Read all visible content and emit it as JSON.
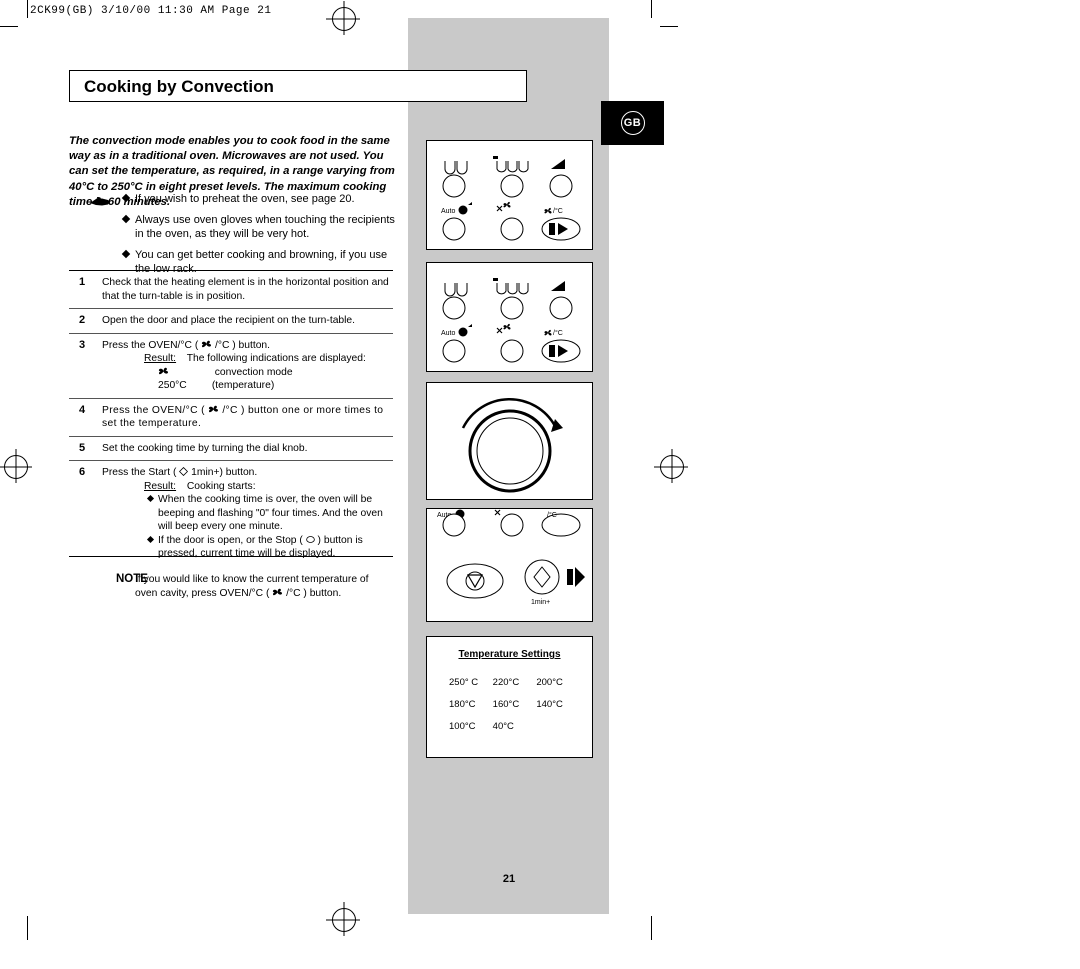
{
  "slug": "2CK99(GB)  3/10/00 11:30 AM  Page 21",
  "page": {
    "title": "Cooking by Convection",
    "locale_badge": "GB",
    "number": "21"
  },
  "intro": "The convection mode enables you to cook food in the same way as in a traditional oven. Microwaves are not used. You can set the temperature, as required, in a range varying from 40°C to 250°C in eight preset levels. The maximum cooking time is 60 minutes.",
  "bullets": [
    "If you wish to preheat the oven, see page 20.",
    "Always use oven gloves when touching the recipients in the oven, as they will be very hot.",
    "You can get better cooking and browning, if you use the low rack."
  ],
  "steps": [
    {
      "num": "1",
      "text": "Check that the heating element is in the horizontal position and that the turn-table is in position."
    },
    {
      "num": "2",
      "text": "Open the door and place the recipient on the turn-table."
    },
    {
      "num": "3",
      "text": "Press the OVEN/°C (        ) button.",
      "result_label": "Result:",
      "result_text": "The following indications are displayed:",
      "sub_items": [
        {
          "left": "",
          "right": "convection mode"
        },
        {
          "left": "250°C",
          "right": "(temperature)"
        }
      ]
    },
    {
      "num": "4",
      "text": "Press the OVEN/°C (        ) button one or more times to set the temperature."
    },
    {
      "num": "5",
      "text": "Set the cooking time by turning the dial knob."
    },
    {
      "num": "6",
      "text": "Press the Start (      1min+) button.",
      "result_label": "Result:",
      "result_text": "Cooking starts:",
      "diamonds": [
        "When the cooking time is over, the oven will be beeping and flashing \"0\" four times. And the oven will beep every one minute.",
        "If the door is open, or the Stop (      ) button is pressed, current time will be displayed."
      ]
    }
  ],
  "note": {
    "label": "NOTE",
    "text": "If you would like to know the current temperature of oven cavity, press OVEN/°C (        ) button."
  },
  "control_panel": {
    "auto_label": "Auto",
    "start_label": "1min+"
  },
  "temperature_settings": {
    "title": "Temperature Settings",
    "values": [
      [
        "250° C",
        "220°C",
        "200°C"
      ],
      [
        "180°C",
        "160°C",
        "140°C"
      ],
      [
        "100°C",
        "40°C",
        ""
      ]
    ]
  }
}
